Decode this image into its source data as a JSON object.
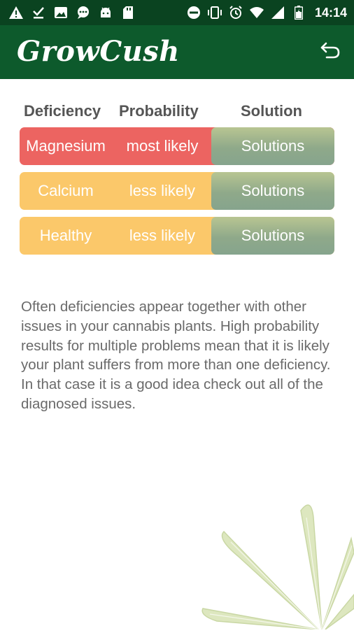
{
  "status_bar": {
    "left_icons": [
      "alert-icon",
      "download-done-icon",
      "image-icon",
      "chat-icon",
      "android-icon",
      "sd-card-icon"
    ],
    "right_icons": [
      "dnd-icon",
      "vibrate-icon",
      "alarm-icon",
      "wifi-icon",
      "signal-icon",
      "battery-icon"
    ],
    "time": "14:14"
  },
  "app_bar": {
    "title": "GrowCush",
    "back_icon": "back-arrow-icon"
  },
  "table": {
    "headers": {
      "deficiency": "Deficiency",
      "probability": "Probability",
      "solution": "Solution"
    },
    "rows": [
      {
        "deficiency": "Magnesium",
        "probability": "most likely",
        "solution": "Solutions",
        "color": "#ec6461"
      },
      {
        "deficiency": "Calcium",
        "probability": "less likely",
        "solution": "Solutions",
        "color": "#fbc86a"
      },
      {
        "deficiency": "Healthy",
        "probability": "less likely",
        "solution": "Solutions",
        "color": "#fbc86a"
      }
    ]
  },
  "info_text": "Often deficiencies appear together with other issues in your cannabis plants. High probability results for multiple problems mean that it is likely your plant suffers from more than one deficiency. In that case it is a good idea check out all of the diagnosed issues.",
  "colors": {
    "status_bar": "#0a4320",
    "app_bar": "#0d5a2c",
    "most_likely": "#ec6461",
    "less_likely": "#fbc86a",
    "solution_button": "#8fa98a"
  }
}
